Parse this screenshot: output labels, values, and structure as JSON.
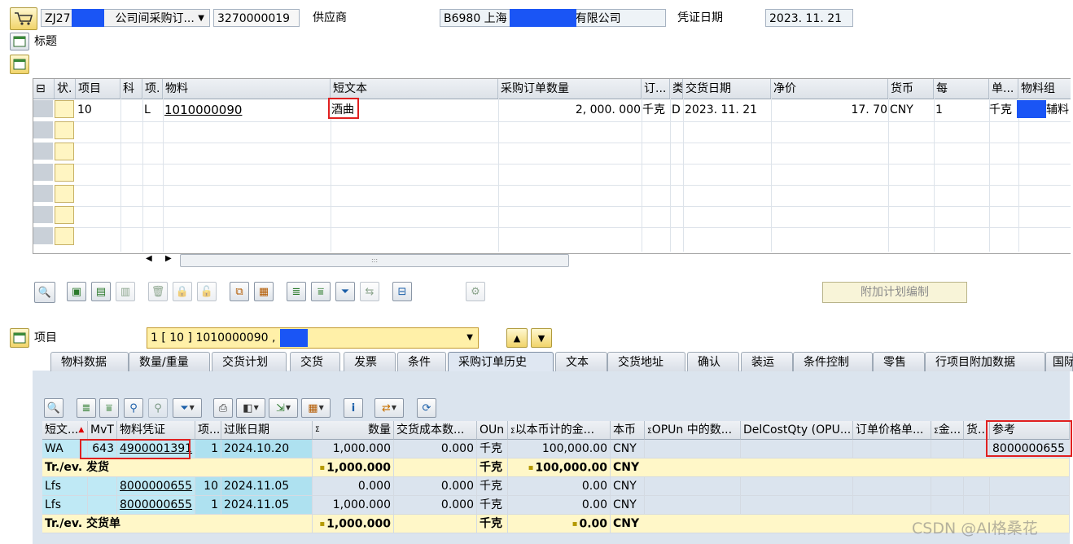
{
  "header": {
    "doc_type": "ZJ27",
    "doc_type_desc": "公司间采购订...",
    "po_number": "3270000019",
    "vendor_label": "供应商",
    "vendor_value": "B6980 上海",
    "vendor_suffix": "有限公司",
    "doc_date_label": "凭证日期",
    "doc_date": "2023. 11. 21",
    "title_label": "标题"
  },
  "items_table": {
    "columns": [
      "状.",
      "项目",
      "科",
      "项.",
      "物料",
      "短文本",
      "采购订单数量",
      "订...",
      "类",
      "交货日期",
      "净价",
      "货币",
      "每",
      "单...",
      "物料组"
    ],
    "row": {
      "item": "10",
      "acct": "",
      "cat": "L",
      "material": "1010000090",
      "short_text": "酒曲",
      "qty": "2, 000. 000",
      "unit": "千克",
      "date_cat": "D",
      "delivery_date": "2023. 11. 21",
      "net_price": "17. 70",
      "currency": "CNY",
      "per": "1",
      "uom": "千克",
      "mat_group": "辅料"
    }
  },
  "buttons": {
    "extra_schedule": "附加计划编制"
  },
  "item_detail": {
    "label": "项目",
    "selector_value": "1 [ 10 ] 1010000090 ,"
  },
  "tabs": [
    "物料数据",
    "数量/重量",
    "交货计划",
    "交货",
    "发票",
    "条件",
    "采购订单历史",
    "文本",
    "交货地址",
    "确认",
    "装运",
    "条件控制",
    "零售",
    "行项目附加数据",
    "国际"
  ],
  "active_tab": "采购订单历史",
  "history_table": {
    "columns": [
      "短文...",
      "MvT",
      "物料凭证",
      "项...",
      "过账日期",
      "数量",
      "交货成本数...",
      "OUn",
      "以本币计的金...",
      "本币",
      "OPUn 中的数...",
      "DelCostQty (OPU...",
      "订单价格单...",
      "金...",
      "货...",
      "参考"
    ],
    "rows": [
      {
        "kind": "data",
        "short": "WA",
        "mvt": "643",
        "doc": "4900001391",
        "item": "1",
        "date": "2024.10.20",
        "qty": "1,000.000",
        "dcost": "0.000",
        "oun": "千克",
        "amount": "100,000.00",
        "cur": "CNY",
        "ref": "8000000655"
      },
      {
        "kind": "sum",
        "short": "Tr./ev. 发货",
        "qty": "1,000.000",
        "oun": "千克",
        "amount": "100,000.00",
        "cur": "CNY"
      },
      {
        "kind": "data2",
        "short": "Lfs",
        "mvt": "",
        "doc": "8000000655",
        "item": "10",
        "date": "2024.11.05",
        "qty": "0.000",
        "dcost": "0.000",
        "oun": "千克",
        "amount": "0.00",
        "cur": "CNY",
        "ref": ""
      },
      {
        "kind": "data2",
        "short": "Lfs",
        "mvt": "",
        "doc": "8000000655",
        "item": "1",
        "date": "2024.11.05",
        "qty": "1,000.000",
        "dcost": "0.000",
        "oun": "千克",
        "amount": "0.00",
        "cur": "CNY",
        "ref": ""
      },
      {
        "kind": "sum",
        "short": "Tr./ev. 交货单",
        "qty": "1,000.000",
        "oun": "千克",
        "amount": "0.00",
        "cur": "CNY"
      }
    ]
  },
  "watermark": "CSDN @AI格桑花"
}
